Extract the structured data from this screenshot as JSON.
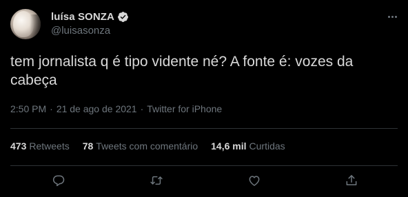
{
  "author": {
    "display_name": "luísa SONZA",
    "handle": "@luisasonza",
    "verified": true,
    "avatar_icon": "profile-photo"
  },
  "tweet": {
    "text": "tem jornalista q é tipo vidente né? A fonte é: vozes da cabeça"
  },
  "meta": {
    "time": "2:50 PM",
    "separator": "·",
    "date": "21 de ago de 2021",
    "source": "Twitter for iPhone"
  },
  "stats": [
    {
      "count": "473",
      "label": "Retweets"
    },
    {
      "count": "78",
      "label": "Tweets com comentário"
    },
    {
      "count": "14,6 mil",
      "label": "Curtidas"
    }
  ],
  "actions": [
    {
      "icon": "reply-icon"
    },
    {
      "icon": "retweet-icon"
    },
    {
      "icon": "like-icon"
    },
    {
      "icon": "share-icon"
    }
  ],
  "colors": {
    "background": "#000000",
    "text": "#d9d9d9",
    "muted": "#6e767d",
    "divider": "#2f3336",
    "verified_badge": "#d9d9d9"
  }
}
